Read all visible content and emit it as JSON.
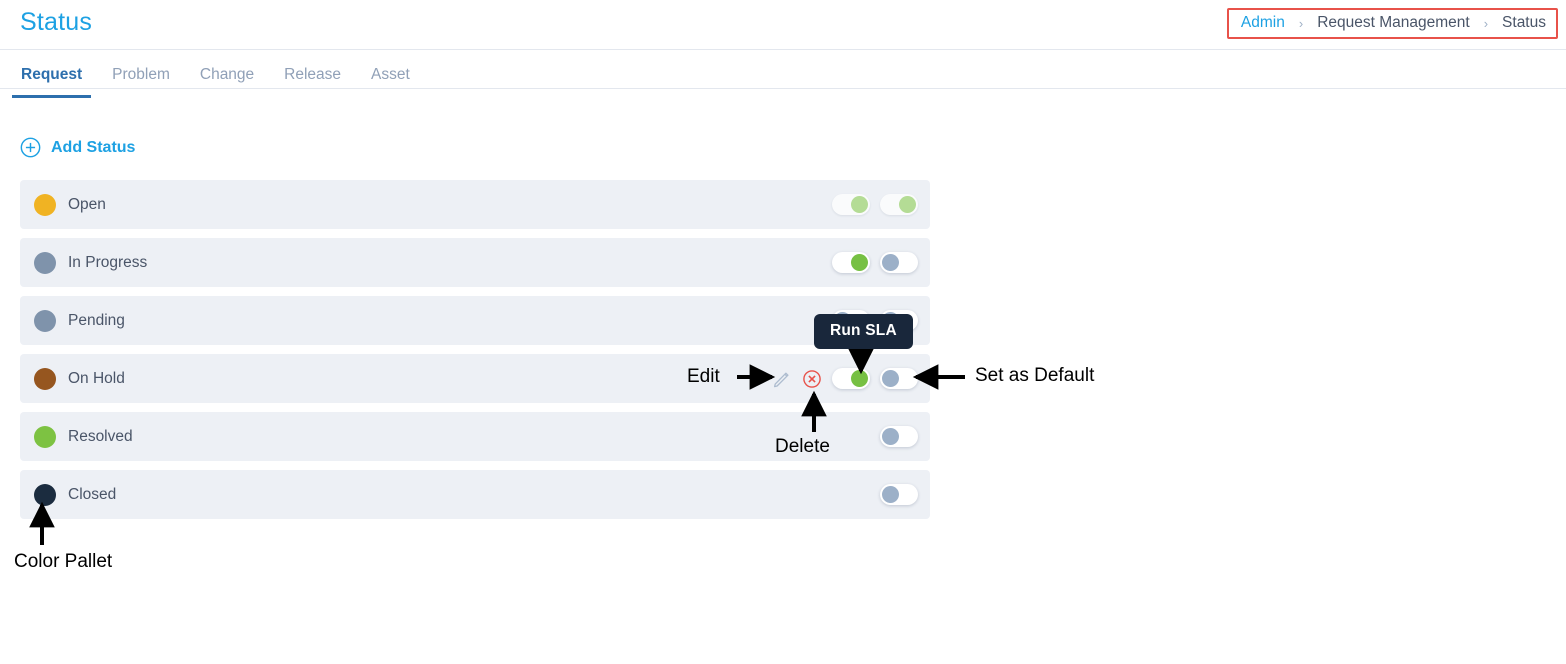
{
  "header": {
    "page_title": "Status",
    "breadcrumb": {
      "items": [
        {
          "label": "Admin",
          "type": "link"
        },
        {
          "label": "Request Management",
          "type": "link"
        },
        {
          "label": "Status",
          "type": "current"
        }
      ],
      "separator": "›",
      "highlight_color": "#e8524a"
    }
  },
  "tabs": [
    {
      "label": "Request",
      "active": true
    },
    {
      "label": "Problem",
      "active": false
    },
    {
      "label": "Change",
      "active": false
    },
    {
      "label": "Release",
      "active": false
    },
    {
      "label": "Asset",
      "active": false
    }
  ],
  "toolbar": {
    "add_status_label": "Add Status",
    "add_status_icon": "plus-circle-icon",
    "accent_color": "#1da1e3"
  },
  "status_list": [
    {
      "name": "Open",
      "color": "#f0b323",
      "edit_icon": false,
      "delete_icon": false,
      "run_sla_toggle": {
        "present": true,
        "state": "on",
        "faded": true
      },
      "default_toggle": {
        "present": true,
        "state": "on",
        "faded": true
      }
    },
    {
      "name": "In Progress",
      "color": "#7f93ab",
      "edit_icon": false,
      "delete_icon": false,
      "run_sla_toggle": {
        "present": true,
        "state": "on",
        "faded": false
      },
      "default_toggle": {
        "present": true,
        "state": "off",
        "faded": false
      }
    },
    {
      "name": "Pending",
      "color": "#7f93ab",
      "edit_icon": false,
      "delete_icon": false,
      "run_sla_toggle": {
        "present": true,
        "state": "off",
        "faded": false
      },
      "default_toggle": {
        "present": true,
        "state": "off",
        "faded": false
      }
    },
    {
      "name": "On Hold",
      "color": "#96561f",
      "edit_icon": true,
      "delete_icon": true,
      "run_sla_toggle": {
        "present": true,
        "state": "on",
        "faded": false
      },
      "default_toggle": {
        "present": true,
        "state": "off",
        "faded": false
      }
    },
    {
      "name": "Resolved",
      "color": "#7dc242",
      "edit_icon": false,
      "delete_icon": false,
      "run_sla_toggle": {
        "present": false,
        "state": "off",
        "faded": false
      },
      "default_toggle": {
        "present": true,
        "state": "off",
        "faded": false
      }
    },
    {
      "name": "Closed",
      "color": "#1b2c3f",
      "edit_icon": false,
      "delete_icon": false,
      "run_sla_toggle": {
        "present": false,
        "state": "off",
        "faded": false
      },
      "default_toggle": {
        "present": true,
        "state": "off",
        "faded": false
      }
    }
  ],
  "tooltip": {
    "label": "Run SLA",
    "background": "#19273b"
  },
  "annotations": [
    {
      "label": "Edit",
      "id": "annotation-edit"
    },
    {
      "label": "Delete",
      "id": "annotation-delete"
    },
    {
      "label": "Set as Default",
      "id": "annotation-set-as-default"
    },
    {
      "label": "Color Pallet",
      "id": "annotation-color-pallet"
    }
  ]
}
